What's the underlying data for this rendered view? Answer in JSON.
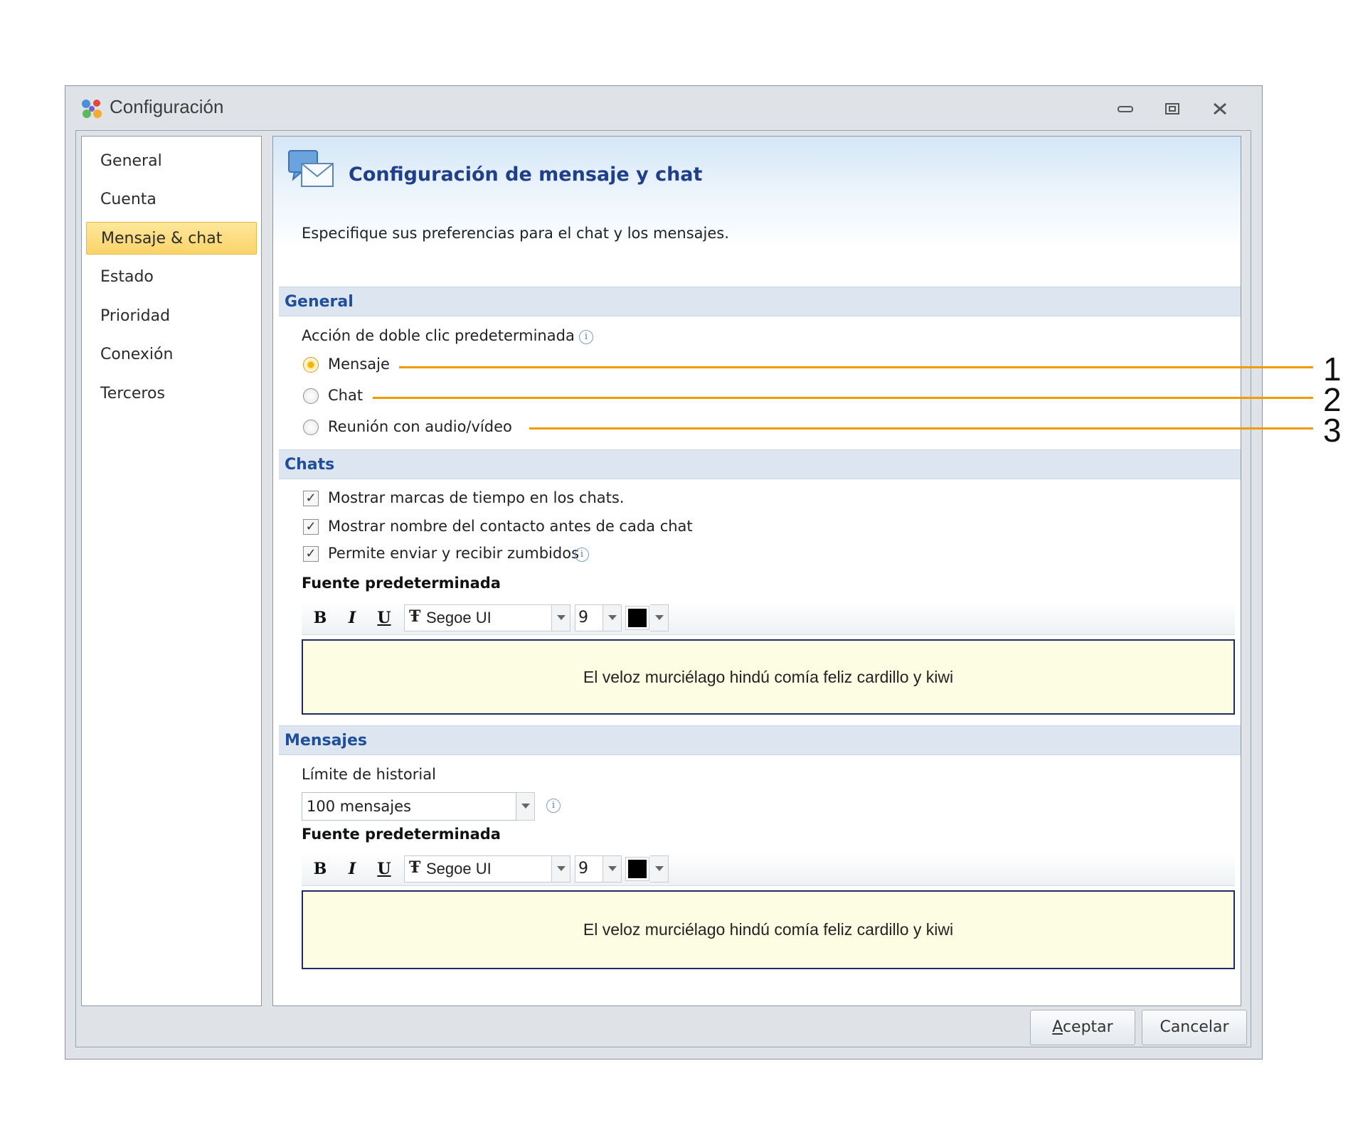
{
  "window": {
    "title": "Configuración",
    "controls": {
      "minimize": "minimize-icon",
      "maximize": "maximize-icon",
      "close": "close-icon"
    }
  },
  "sidebar": {
    "items": [
      {
        "label": "General"
      },
      {
        "label": "Cuenta"
      },
      {
        "label": "Mensaje & chat",
        "selected": true
      },
      {
        "label": "Estado"
      },
      {
        "label": "Prioridad"
      },
      {
        "label": "Conexión"
      },
      {
        "label": "Terceros"
      }
    ]
  },
  "panel": {
    "title": "Configuración de mensaje y chat",
    "description": "Especifique sus preferencias para el chat  y los mensajes."
  },
  "general": {
    "heading": "General",
    "double_click_label": "Acción de doble clic predeterminada",
    "options": [
      {
        "label": "Mensaje",
        "checked": true
      },
      {
        "label": "Chat",
        "checked": false
      },
      {
        "label": "Reunión con audio/vídeo",
        "checked": false
      }
    ]
  },
  "chats": {
    "heading": "Chats",
    "checkboxes": [
      {
        "label": "Mostrar marcas de tiempo en los chats.",
        "checked": true
      },
      {
        "label": "Mostrar nombre del contacto antes de cada chat",
        "checked": true
      },
      {
        "label": "Permite enviar y recibir zumbidos",
        "checked": true
      }
    ],
    "font_label": "Fuente predeterminada",
    "font": {
      "bold": "B",
      "italic": "I",
      "underline": "U",
      "tt": "Ŧ",
      "family": "Segoe UI",
      "size": "9",
      "color": "#000000"
    },
    "preview": "El veloz murciélago hindú comía feliz cardillo y kiwi"
  },
  "messages": {
    "heading": "Mensajes",
    "history_label": "Límite de historial",
    "history_value": "100 mensajes",
    "font_label": "Fuente predeterminada",
    "font": {
      "bold": "B",
      "italic": "I",
      "underline": "U",
      "tt": "Ŧ",
      "family": "Segoe UI",
      "size": "9",
      "color": "#000000"
    },
    "preview": "El veloz murciélago hindú comía feliz cardillo y kiwi"
  },
  "footer": {
    "accept": "Aceptar",
    "cancel": "Cancelar"
  },
  "info_glyph": "i",
  "callouts": [
    "1",
    "2",
    "3"
  ],
  "colors": {
    "accent": "#1f3f8a",
    "callout": "#f29a00",
    "selected": "#fbd46a"
  }
}
